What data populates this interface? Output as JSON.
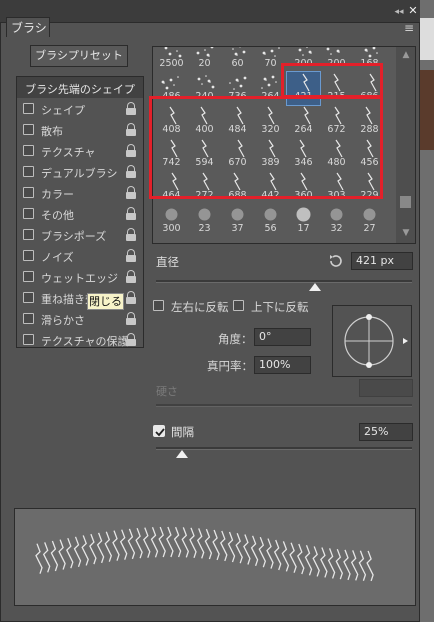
{
  "panel": {
    "title": "ブラシ",
    "menu_icon": "panel-menu-icon"
  },
  "window": {
    "collapse": "◂◂",
    "close": "✕"
  },
  "preset_button": "ブラシプリセット",
  "options": {
    "header": "ブラシ先端のシェイプ",
    "items": [
      {
        "label": "シェイプ",
        "locked": true
      },
      {
        "label": "散布",
        "locked": true
      },
      {
        "label": "テクスチャ",
        "locked": true
      },
      {
        "label": "デュアルブラシ",
        "locked": true
      },
      {
        "label": "カラー",
        "locked": true
      },
      {
        "label": "その他",
        "locked": true
      },
      {
        "label": "ブラシポーズ",
        "locked": true
      },
      {
        "label": "ノイズ",
        "locked": true
      },
      {
        "label": "ウェットエッジ",
        "locked": true
      },
      {
        "label": "重ね描き効果",
        "locked": true
      },
      {
        "label": "滑らかさ",
        "locked": true
      },
      {
        "label": "テクスチャの保護",
        "locked": true
      }
    ],
    "tooltip": "閉じる"
  },
  "brushes": {
    "rows": [
      [
        "2500",
        "20",
        "60",
        "70",
        "200",
        "200",
        "168"
      ],
      [
        "486",
        "240",
        "736",
        "264",
        "421",
        "215",
        "686"
      ],
      [
        "408",
        "400",
        "484",
        "320",
        "264",
        "672",
        "288"
      ],
      [
        "742",
        "594",
        "670",
        "389",
        "346",
        "480",
        "456"
      ],
      [
        "464",
        "272",
        "688",
        "442",
        "360",
        "303",
        "229"
      ],
      [
        "300",
        "23",
        "37",
        "56",
        "17",
        "32",
        "27"
      ]
    ],
    "selected": "421"
  },
  "diameter": {
    "label": "直径",
    "value": "421 px",
    "slider": 0.62
  },
  "flip_x": "左右に反転",
  "flip_y": "上下に反転",
  "angle": {
    "label": "角度：",
    "value": "0°"
  },
  "roundness": {
    "label": "真円率：",
    "value": "100%"
  },
  "hardness": {
    "label": "硬さ"
  },
  "spacing": {
    "label": "間隔",
    "value": "25%",
    "checked": true,
    "slider": 0.1
  },
  "colors": {
    "highlight": "#e3202a",
    "selection": "#3d5f88",
    "panel": "#535353"
  }
}
